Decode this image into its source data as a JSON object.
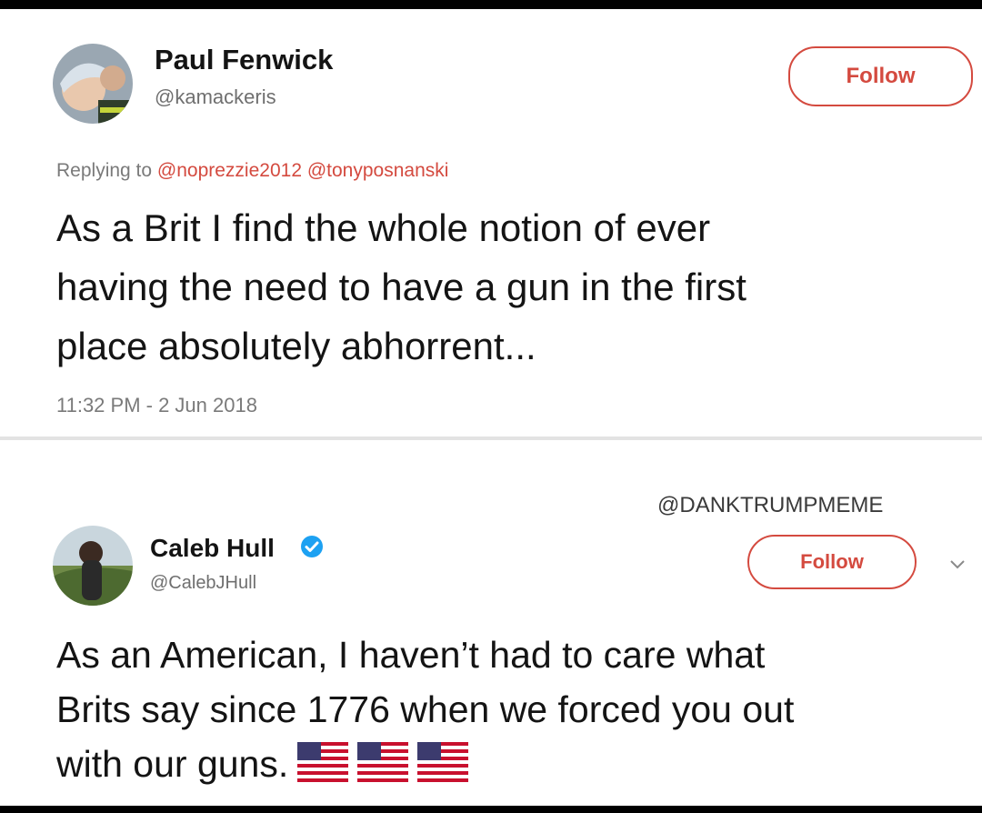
{
  "tweets": [
    {
      "name": "Paul Fenwick",
      "handle": "@kamackeris",
      "follow_label": "Follow",
      "reply_prefix": "Replying to",
      "reply_mentions": [
        "@noprezzie2012",
        "@tonyposnanski"
      ],
      "text_lines": [
        "As a Brit I find the whole notion of ever",
        "having the need to have a gun in the first",
        "place absolutely abhorrent..."
      ],
      "timestamp": "11:32 PM - 2 Jun 2018"
    },
    {
      "watermark": "@DANKTRUMPMEME",
      "name": "Caleb Hull",
      "verified": true,
      "handle": "@CalebJHull",
      "follow_label": "Follow",
      "text_lines": [
        "As an American, I haven’t had to care what",
        "Brits say since 1776 when we forced you out",
        "with our guns."
      ],
      "emoji": [
        "us-flag-icon",
        "us-flag-icon",
        "us-flag-icon"
      ]
    }
  ],
  "colors": {
    "accent": "#d44a3f",
    "verified": "#1da1f2",
    "muted": "#7a7a7a"
  }
}
